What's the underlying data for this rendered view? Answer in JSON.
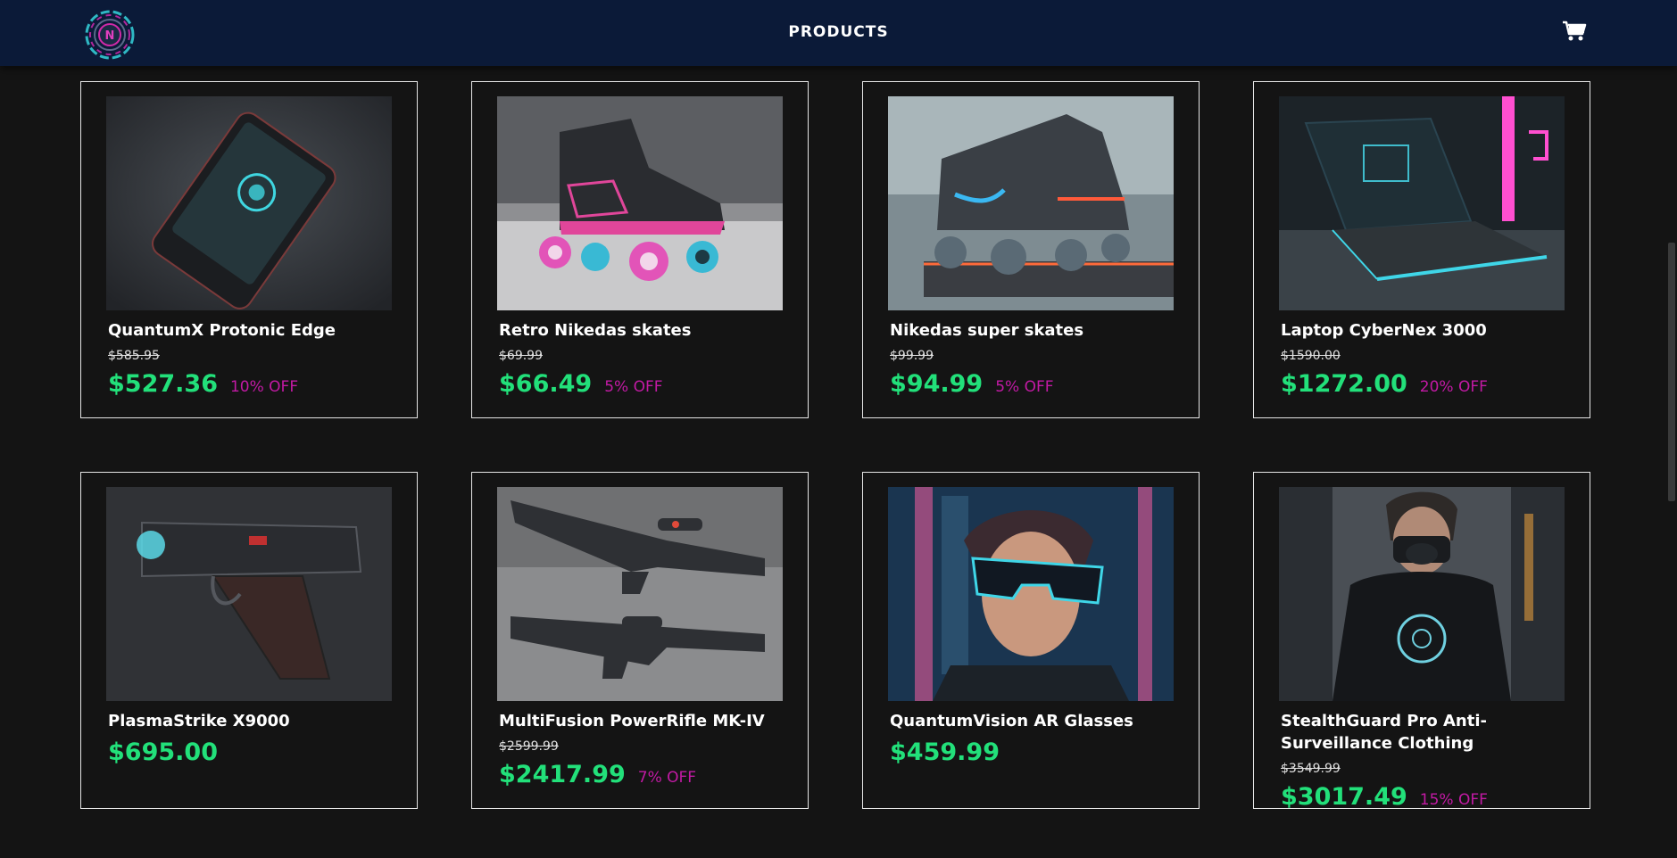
{
  "header": {
    "logo_letter": "N",
    "title": "PRODUCTS",
    "cart_icon": "cart-icon"
  },
  "products": [
    {
      "name": "QuantumX Protonic Edge",
      "old_price": "$585.95",
      "price": "$527.36",
      "discount": "10% OFF",
      "image": "phone"
    },
    {
      "name": "Retro Nikedas skates",
      "old_price": "$69.99",
      "price": "$66.49",
      "discount": "5% OFF",
      "image": "skate-pink"
    },
    {
      "name": "Nikedas super skates",
      "old_price": "$99.99",
      "price": "$94.99",
      "discount": "5% OFF",
      "image": "skate-neon"
    },
    {
      "name": "Laptop CyberNex 3000",
      "old_price": "$1590.00",
      "price": "$1272.00",
      "discount": "20% OFF",
      "image": "laptop"
    },
    {
      "name": "PlasmaStrike X9000",
      "old_price": "",
      "price": "$695.00",
      "discount": "",
      "image": "pistol"
    },
    {
      "name": "MultiFusion PowerRifle MK-IV",
      "old_price": "$2599.99",
      "price": "$2417.99",
      "discount": "7% OFF",
      "image": "rifle"
    },
    {
      "name": "QuantumVision AR Glasses",
      "old_price": "",
      "price": "$459.99",
      "discount": "",
      "image": "ar-glasses"
    },
    {
      "name": "StealthGuard Pro Anti-Surveillance Clothing",
      "old_price": "$3549.99",
      "price": "$3017.49",
      "discount": "15% OFF",
      "image": "clothing"
    }
  ],
  "colors": {
    "navbar": "#0b1a38",
    "background": "#141414",
    "price": "#22e07a",
    "discount": "#c21aa4"
  }
}
